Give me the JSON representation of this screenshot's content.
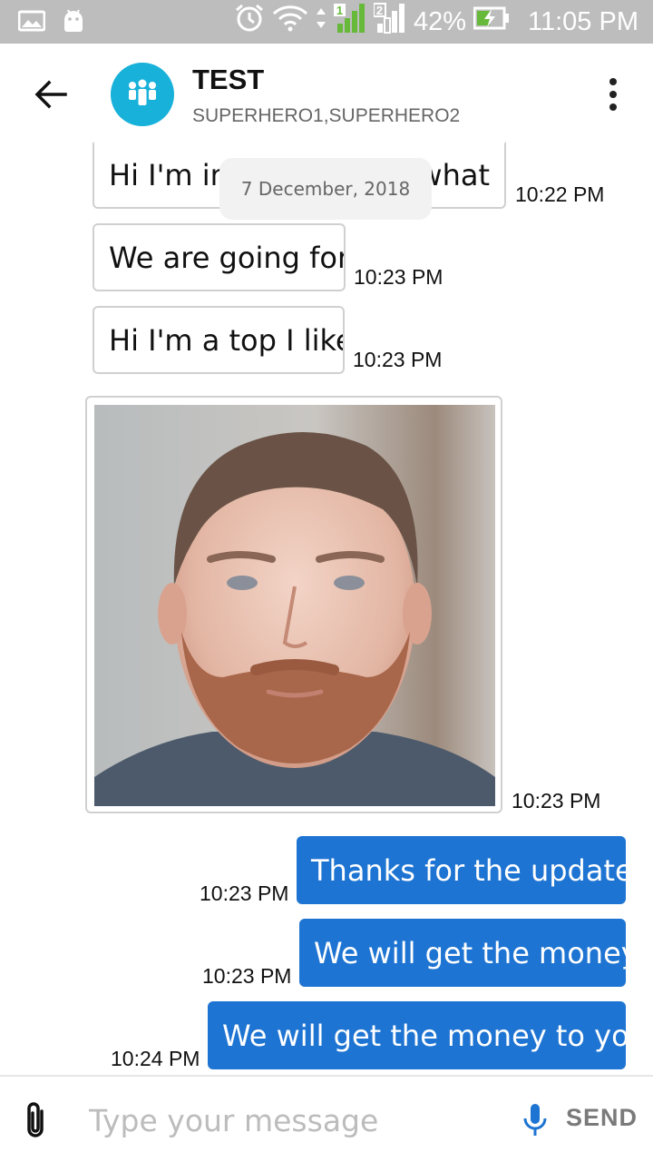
{
  "status_bar": {
    "battery": "42%",
    "time": "11:05 PM",
    "sim1": "1",
    "sim2": "2"
  },
  "header": {
    "title": "TEST",
    "subtitle": "SUPERHERO1,SUPERHERO2",
    "avatar_icon": "group-icon",
    "accent": "#17b1d9"
  },
  "date_chip": "7 December, 2018",
  "messages": [
    {
      "direction": "incoming",
      "text": "Hi I'm int",
      "text_tail": "what",
      "time": "10:22 PM"
    },
    {
      "direction": "incoming",
      "text": "We are going for",
      "time": "10:23 PM"
    },
    {
      "direction": "incoming",
      "text": "Hi I'm a top I like",
      "time": "10:23 PM"
    },
    {
      "direction": "incoming",
      "type": "image",
      "time": "10:23 PM"
    },
    {
      "direction": "outgoing",
      "text": "Thanks for the update",
      "time": "10:23 PM"
    },
    {
      "direction": "outgoing",
      "text": "We will get the money",
      "time": "10:23 PM"
    },
    {
      "direction": "outgoing",
      "text": "We will get the money to you",
      "time": "10:24 PM"
    }
  ],
  "composer": {
    "placeholder": "Type your message",
    "send_label": "SEND"
  },
  "colors": {
    "outgoing_bubble": "#1e74d2",
    "incoming_border": "#d0d0d0",
    "status_bar": "#bdbdbd"
  }
}
